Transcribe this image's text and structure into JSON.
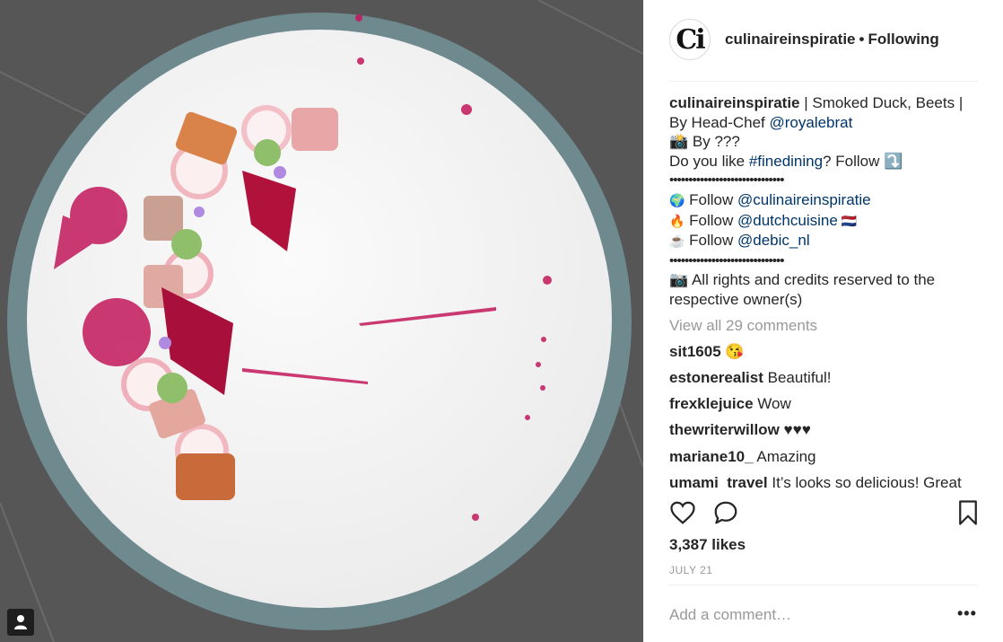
{
  "post": {
    "username": "culinaireinspiratie",
    "follow_status": "Following",
    "avatar_text": "Ci",
    "caption_title": " | Smoked Duck, Beets | By Head-Chef ",
    "caption_chef": "@royalebrat",
    "caption_line2": "📸  By ???",
    "caption_line3_a": "Do you like ",
    "caption_hashtag": "#finedining",
    "caption_line3_b": "? Follow ⤵️",
    "dots": "••••••••••••••••••••••••••••••",
    "follow1_emoji": "🌍",
    "follow2_emoji": "🔥",
    "follow3_emoji": "☕",
    "follow_word": " Follow ",
    "follow1_handle": "@culinaireinspiratie",
    "follow2_handle": "@dutchcuisine",
    "follow2_flag": " 🇳🇱",
    "follow3_handle": "@debic_nl",
    "rights": "📷  All rights and credits reserved to the respective owner(s)",
    "view_all": "View all 29 comments",
    "comments": [
      {
        "user": "sit1605",
        "text": " 😘"
      },
      {
        "user": "estonerealist",
        "text": " Beautiful!"
      },
      {
        "user": "frexklejuice",
        "text": " Wow"
      },
      {
        "user": "thewriterwillow",
        "text": " ♥♥♥"
      },
      {
        "user": "mariane10_",
        "text": " Amazing"
      },
      {
        "user": "umami_travel",
        "text": " It’s looks so delicious! Great"
      }
    ],
    "likes": "3,387 likes",
    "date": "JULY 21",
    "add_comment_placeholder": "Add a comment…",
    "more_options": "•••"
  },
  "icons": {
    "like": "heart-icon",
    "comment": "speech-bubble-icon",
    "save": "bookmark-icon",
    "tagged_user": "user-tag-icon"
  },
  "colors": {
    "link": "#003569",
    "muted": "#999999",
    "photo_background": "#545454",
    "plate_rim": "#6f8a8e"
  }
}
